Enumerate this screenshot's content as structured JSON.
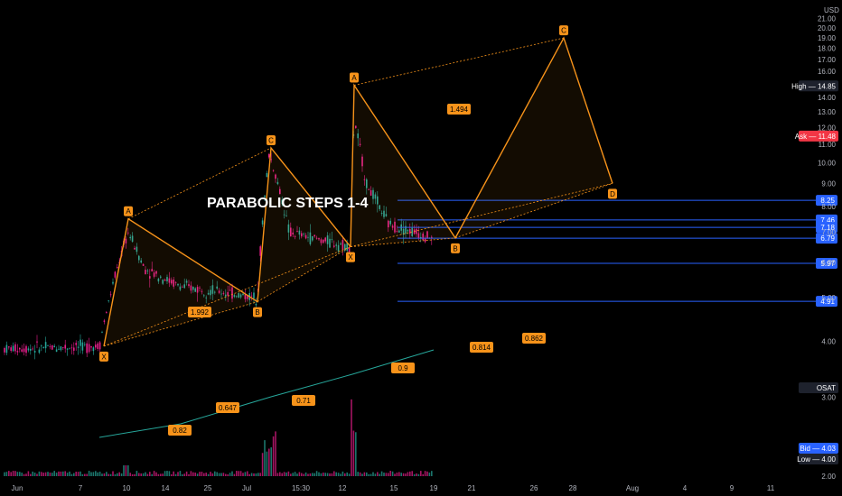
{
  "chart_data": {
    "type": "line",
    "title": "PARABOLIC STEPS 1-4",
    "currency": "USD",
    "y_axis": {
      "ticks": [
        2,
        3,
        4,
        5,
        6,
        7,
        8,
        9,
        10,
        11,
        12,
        13,
        14,
        15,
        16,
        17,
        18,
        19,
        20,
        21
      ],
      "tick_labels": [
        "2.00",
        "3.00",
        "4.00",
        "5.00",
        "6.00",
        "7.00",
        "8.00",
        "9.00",
        "10.00",
        "11.00",
        "12.00",
        "13.00",
        "14.00",
        "15.00",
        "16.00",
        "17.00",
        "18.00",
        "19.00",
        "20.00",
        "21.00"
      ],
      "scale": "log"
    },
    "x_axis": {
      "tick_labels": [
        "Jun",
        "7",
        "10",
        "14",
        "25",
        "Jul",
        "15:30",
        "12",
        "15",
        "19",
        "21",
        "26",
        "28",
        "Aug",
        "4",
        "9",
        "11"
      ]
    },
    "harmonic_pattern_1": {
      "points": [
        {
          "label": "X",
          "date": "Jun 9",
          "price": 3.9
        },
        {
          "label": "A",
          "date": "Jun 10",
          "price": 7.5
        },
        {
          "label": "B",
          "date": "Jun 30",
          "price": 4.9
        },
        {
          "label": "C",
          "date": "Jul 2",
          "price": 10.8
        },
        {
          "label": "X",
          "date": "Jul 12",
          "price": 6.5
        }
      ],
      "ratios": [
        "1.992",
        "0.647",
        "0.82",
        "0.71"
      ]
    },
    "harmonic_pattern_2": {
      "points": [
        {
          "label": "X",
          "date": "Jul 12",
          "price": 6.5
        },
        {
          "label": "A",
          "date": "Jul 13",
          "price": 14.9
        },
        {
          "label": "B",
          "date": "Jul 20",
          "price": 6.8
        },
        {
          "label": "C",
          "date": "Jul 27",
          "price": 19.0
        },
        {
          "label": "D",
          "date": "Jul 31",
          "price": 9.0
        }
      ],
      "ratios": [
        "1.494",
        "0.814",
        "0.862",
        "0.9"
      ]
    },
    "price_levels": [
      {
        "value": "8.25",
        "color": "#2962ff"
      },
      {
        "value": "7.46",
        "color": "#2962ff"
      },
      {
        "value": "7.18",
        "color": "#2962ff"
      },
      {
        "value": "6.79",
        "color": "#2962ff"
      },
      {
        "value": "5.97",
        "color": "#2962ff"
      },
      {
        "value": "4.91",
        "color": "#2962ff"
      }
    ],
    "price_tags": [
      {
        "label": "High",
        "value": "14.85",
        "color": "#1e222d"
      },
      {
        "label": "Ask",
        "value": "11.48",
        "color": "#f23645"
      },
      {
        "label": "OSAT",
        "value": "",
        "color": "#1e222d"
      },
      {
        "label": "Bid",
        "value": "4.03",
        "color": "#2962ff"
      },
      {
        "label": "Low",
        "value": "4.00",
        "color": "#1e222d"
      }
    ],
    "colors": {
      "pattern": "#f7931a",
      "up": "#26a69a",
      "down": "#e91e8c",
      "level": "#2962ff"
    }
  }
}
